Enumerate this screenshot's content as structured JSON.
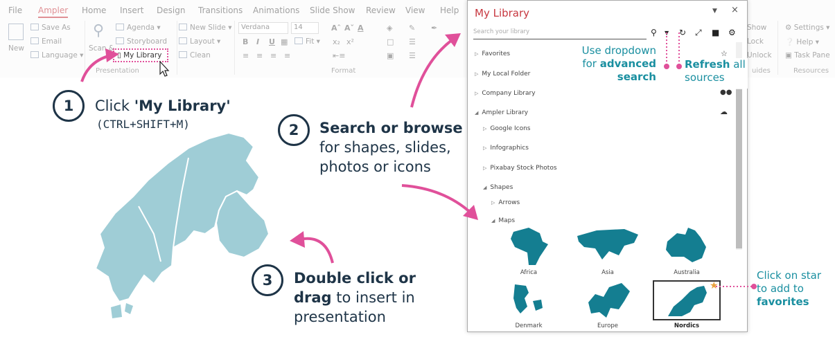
{
  "ribbon": {
    "tabs": [
      "File",
      "Ampler",
      "Home",
      "Insert",
      "Design",
      "Transitions",
      "Animations",
      "Slide Show",
      "Review",
      "View",
      "Help"
    ],
    "new_label": "New",
    "file_items": [
      "Save As",
      "Email",
      "Language"
    ],
    "scan_label": "Scan &",
    "presentation_items": [
      "Agenda",
      "Storyboard",
      "My Library"
    ],
    "slide_items": [
      "New Slide",
      "Layout",
      "Clean"
    ],
    "font_name": "Verdana",
    "font_size": "14",
    "fit_label": "Fit",
    "group_presentation": "Presentation",
    "group_format": "Format",
    "right_items": [
      "Show",
      "Lock",
      "Unlock"
    ],
    "guides_label": "uides",
    "settings_items": [
      "Settings",
      "Help",
      "Task Pane"
    ],
    "group_resources": "Resources"
  },
  "panel": {
    "title": "My Library",
    "search_placeholder": "Search your library",
    "tree": [
      "Favorites",
      "My Local Folder",
      "Company Library",
      "Ampler Library",
      "Google Icons",
      "Infographics",
      "Pixabay Stock Photos",
      "Shapes",
      "Arrows",
      "Maps"
    ],
    "maps": [
      "Africa",
      "Asia",
      "Australia",
      "Denmark",
      "Europe",
      "Nordics"
    ]
  },
  "callouts": {
    "dropdown_1": "Use dropdown",
    "dropdown_2": "for",
    "dropdown_3": "advanced",
    "dropdown_4": "search",
    "refresh_1": "Refresh",
    "refresh_2": "all",
    "refresh_3": "sources",
    "star_1": "Click on star",
    "star_2": "to add to",
    "star_3": "favorites"
  },
  "steps": {
    "one_num": "1",
    "one_a": "Click",
    "one_b": "'My Library'",
    "one_c": "(CTRL+SHIFT+M)",
    "two_num": "2",
    "two_a": "Search or browse",
    "two_b": "for shapes, slides,",
    "two_c": "photos or icons",
    "three_num": "3",
    "three_a": "Double click or",
    "three_b": "drag",
    "three_c": "to insert in",
    "three_d": "presentation"
  },
  "colors": {
    "accent_red": "#c7373f",
    "teal": "#1a8fa0",
    "map_blue": "#147e91",
    "nordic_fill": "#9fcdd6",
    "pink": "#e0509a",
    "navy": "#1e3447"
  }
}
